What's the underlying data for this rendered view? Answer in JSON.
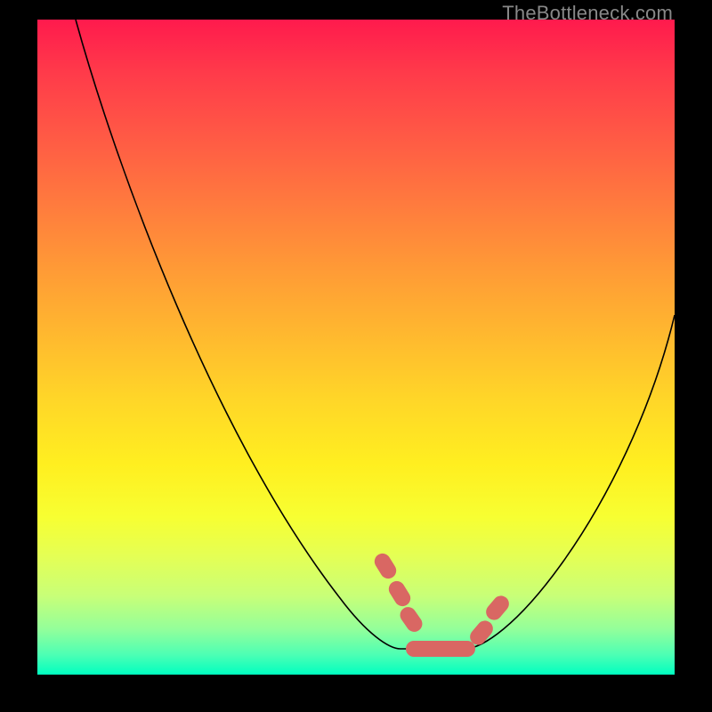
{
  "attribution": "TheBottleneck.com",
  "colors": {
    "frame_bg_top": "#ff1a4d",
    "frame_bg_bottom": "#00ffc0",
    "border": "#000000",
    "curve": "#000000",
    "blob": "#d96763",
    "attribution_text": "#888888"
  },
  "chart_data": {
    "type": "line",
    "title": "",
    "xlabel": "",
    "ylabel": "",
    "xlim": [
      0,
      100
    ],
    "ylim": [
      0,
      100
    ],
    "grid": false,
    "legend": false,
    "left_branch": {
      "x": [
        6,
        57
      ],
      "y": [
        100,
        4
      ]
    },
    "flat_bottom": {
      "x": [
        57,
        67
      ],
      "y": [
        4,
        4
      ]
    },
    "right_branch": {
      "x": [
        67,
        100
      ],
      "y": [
        4,
        55
      ]
    },
    "blob_segments": [
      {
        "x": [
          52.5,
          57
        ],
        "y_top": [
          18,
          5
        ],
        "y_bottom": [
          14,
          3
        ]
      },
      {
        "x": [
          57,
          67
        ],
        "y_top": [
          5.5,
          5.5
        ],
        "y_bottom": [
          2.5,
          2.5
        ]
      },
      {
        "x": [
          67,
          71
        ],
        "y_top": [
          5,
          12
        ],
        "y_bottom": [
          3,
          8
        ]
      }
    ],
    "notes": "V-shaped curve with a flat valley ~4% height between x≈57 and x≈67; blobs are thick pink-red overlays on the valley and short adjacent slopes."
  }
}
